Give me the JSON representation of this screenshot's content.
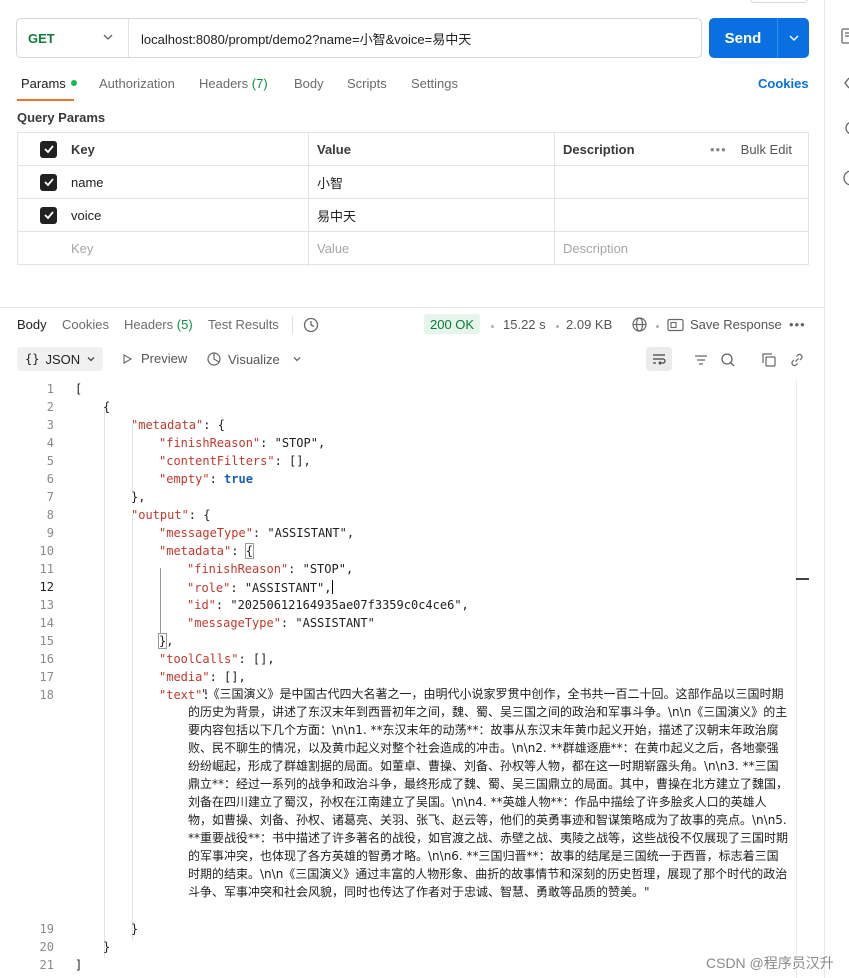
{
  "request": {
    "method": "GET",
    "url": "localhost:8080/prompt/demo2?name=小智&voice=易中天",
    "send_label": "Send"
  },
  "request_tabs": {
    "params": "Params",
    "authorization": "Authorization",
    "headers": "Headers",
    "headers_count": "(7)",
    "body": "Body",
    "scripts": "Scripts",
    "settings": "Settings",
    "cookies": "Cookies"
  },
  "query_params": {
    "title": "Query Params",
    "headers": {
      "key": "Key",
      "value": "Value",
      "description": "Description",
      "bulk_edit": "Bulk Edit"
    },
    "rows": [
      {
        "key": "name",
        "value": "小智",
        "checked": true
      },
      {
        "key": "voice",
        "value": "易中天",
        "checked": true
      }
    ],
    "placeholder": {
      "key": "Key",
      "value": "Value",
      "description": "Description"
    }
  },
  "response_tabs": {
    "body": "Body",
    "cookies": "Cookies",
    "headers": "Headers",
    "headers_count": "(5)",
    "test_results": "Test Results"
  },
  "response_meta": {
    "status": "200 OK",
    "time": "15.22 s",
    "size": "2.09 KB",
    "save_response": "Save Response"
  },
  "response_toolbar": {
    "format": "JSON",
    "preview": "Preview",
    "visualize": "Visualize"
  },
  "code": {
    "line_numbers": [
      "1",
      "2",
      "3",
      "4",
      "5",
      "6",
      "7",
      "8",
      "9",
      "10",
      "11",
      "12",
      "13",
      "14",
      "15",
      "16",
      "17",
      "18",
      "19",
      "20",
      "21"
    ],
    "metadata_key": "\"metadata\"",
    "finishReason_key": "\"finishReason\"",
    "finishReason_val": "\"STOP\"",
    "contentFilters_key": "\"contentFilters\"",
    "empty_key": "\"empty\"",
    "empty_val": "true",
    "output_key": "\"output\"",
    "messageType_key": "\"messageType\"",
    "messageType_val": "\"ASSISTANT\"",
    "role_key": "\"role\"",
    "role_val": "\"ASSISTANT\"",
    "id_key": "\"id\"",
    "id_val": "\"20250612164935ae07f3359c0c4ce6\"",
    "toolCalls_key": "\"toolCalls\"",
    "media_key": "\"media\"",
    "text_key": "\"text\"",
    "text_val": "\"《三国演义》是中国古代四大名著之一，由明代小说家罗贯中创作，全书共一百二十回。这部作品以三国时期的历史为背景，讲述了东汉末年到西晋初年之间，魏、蜀、吴三国之间的政治和军事斗争。\\n\\n《三国演义》的主要内容包括以下几个方面：\\n\\n1. **东汉末年的动荡**：故事从东汉末年黄巾起义开始，描述了汉朝末年政治腐败、民不聊生的情况，以及黄巾起义对整个社会造成的冲击。\\n\\n2. **群雄逐鹿**：在黄巾起义之后，各地豪强纷纷崛起，形成了群雄割据的局面。如董卓、曹操、刘备、孙权等人物，都在这一时期崭露头角。\\n\\n3. **三国鼎立**：经过一系列的战争和政治斗争，最终形成了魏、蜀、吴三国鼎立的局面。其中，曹操在北方建立了魏国，刘备在四川建立了蜀汉，孙权在江南建立了吴国。\\n\\n4. **英雄人物**：作品中描绘了许多脍炙人口的英雄人物，如曹操、刘备、孙权、诸葛亮、关羽、张飞、赵云等，他们的英勇事迹和智谋策略成为了故事的亮点。\\n\\n5. **重要战役**：书中描述了许多著名的战役，如官渡之战、赤壁之战、夷陵之战等，这些战役不仅展现了三国时期的军事冲突，也体现了各方英雄的智勇才略。\\n\\n6. **三国归晋**：故事的结尾是三国统一于西晋，标志着三国时期的结束。\\n\\n《三国演义》通过丰富的人物形象、曲折的故事情节和深刻的历史哲理，展现了那个时代的政治斗争、军事冲突和社会风貌，同时也传达了作者对于忠诚、智慧、勇敢等品质的赞美。\""
  },
  "watermark": "CSDN @程序员汉升",
  "colors": {
    "accent": "#0a6fe0",
    "method": "#127a3b",
    "key": "#c0392b",
    "tab_underline": "#f0702e"
  }
}
